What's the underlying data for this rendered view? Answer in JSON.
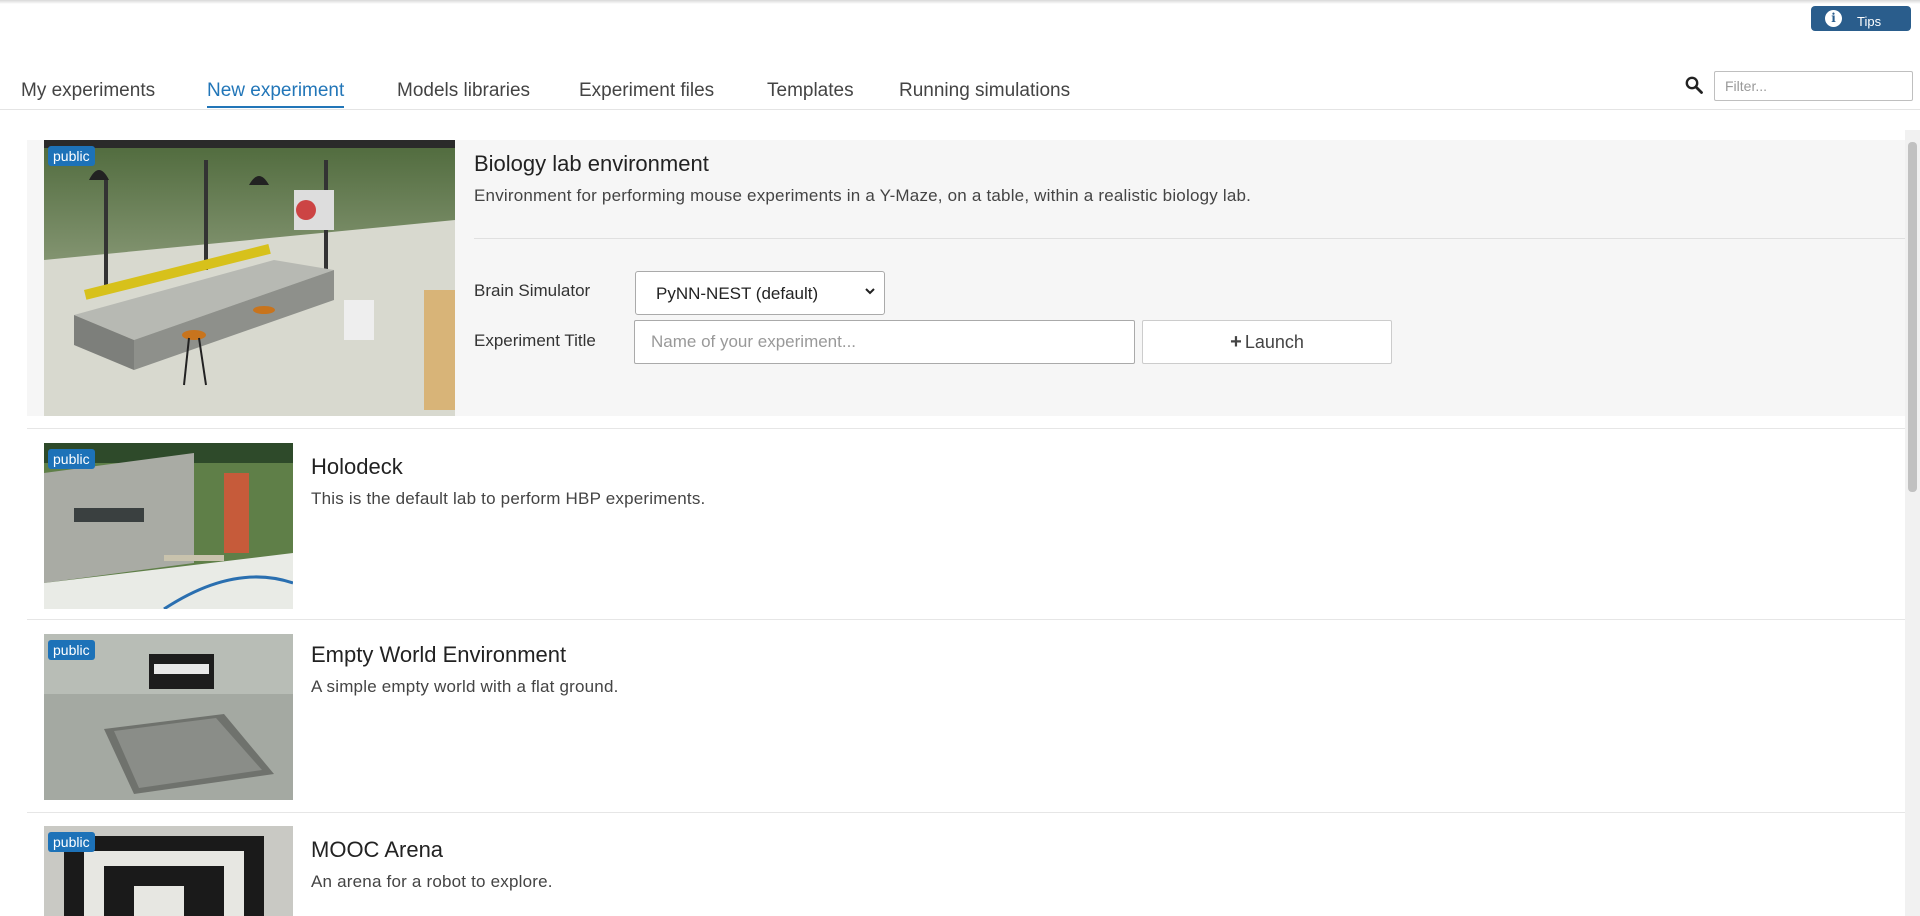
{
  "tips": {
    "label": "Tips",
    "icon": "info-icon"
  },
  "tabs": [
    {
      "label": "My experiments"
    },
    {
      "label": "New experiment",
      "active": true
    },
    {
      "label": "Models libraries"
    },
    {
      "label": "Experiment files"
    },
    {
      "label": "Templates"
    },
    {
      "label": "Running simulations"
    }
  ],
  "search": {
    "placeholder": "Filter...",
    "icon": "search-icon"
  },
  "colors": {
    "accent": "#2276b8",
    "badge": "#1d72b8",
    "tips_bg": "#2a5d8c"
  },
  "experiments": [
    {
      "badge": "public",
      "title": "Biology lab environment",
      "description": "Environment for performing mouse experiments in a Y-Maze, on a table, within a realistic biology lab.",
      "selected": true
    },
    {
      "badge": "public",
      "title": "Holodeck",
      "description": "This is the default lab to perform HBP experiments."
    },
    {
      "badge": "public",
      "title": "Empty World Environment",
      "description": "A simple empty world with a flat ground."
    },
    {
      "badge": "public",
      "title": "MOOC Arena",
      "description": "An arena for a robot to explore."
    }
  ],
  "launch_form": {
    "brain_simulator_label": "Brain Simulator",
    "brain_simulator_value": "PyNN-NEST (default)",
    "experiment_title_label": "Experiment Title",
    "experiment_title_placeholder": "Name of your experiment...",
    "launch_label": "Launch"
  }
}
